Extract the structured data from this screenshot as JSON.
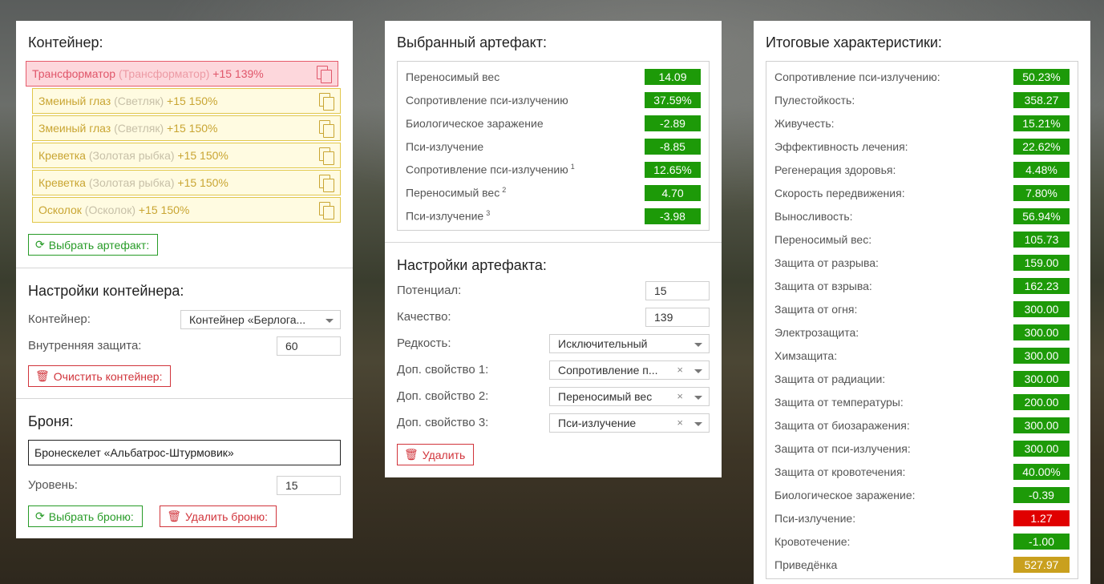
{
  "container_panel": {
    "title": "Контейнер:",
    "artifacts": [
      {
        "name": "Трансформатор",
        "original": "(Трансформатор)",
        "bonus": "+15 139%",
        "selected": true
      },
      {
        "name": "Змеиный глаз",
        "original": "(Светляк)",
        "bonus": "+15 150%",
        "selected": false
      },
      {
        "name": "Змеиный глаз",
        "original": "(Светляк)",
        "bonus": "+15 150%",
        "selected": false
      },
      {
        "name": "Креветка",
        "original": "(Золотая рыбка)",
        "bonus": "+15 150%",
        "selected": false
      },
      {
        "name": "Креветка",
        "original": "(Золотая рыбка)",
        "bonus": "+15 150%",
        "selected": false
      },
      {
        "name": "Осколок",
        "original": "(Осколок)",
        "bonus": "+15 150%",
        "selected": false
      }
    ],
    "choose_artifact_label": "Выбрать артефакт:"
  },
  "container_settings": {
    "title": "Настройки контейнера:",
    "container_label": "Контейнер:",
    "container_value": "Контейнер «Берлога...",
    "inner_protection_label": "Внутренняя защита:",
    "inner_protection_value": "60",
    "clear_label": "Очистить контейнер:"
  },
  "armor": {
    "title": "Броня:",
    "armor_value": "Бронескелет «Альбатрос-Штурмовик»",
    "level_label": "Уровень:",
    "level_value": "15",
    "choose_label": "Выбрать броню:",
    "delete_label": "Удалить броню:"
  },
  "selected_artifact": {
    "title": "Выбранный артефакт:",
    "stats": [
      {
        "label": "Переносимый вес",
        "sup": "",
        "value": "14.09"
      },
      {
        "label": "Сопротивление пси-излучению",
        "sup": "",
        "value": "37.59%"
      },
      {
        "label": "Биологическое заражение",
        "sup": "",
        "value": "-2.89"
      },
      {
        "label": "Пси-излучение",
        "sup": "",
        "value": "-8.85"
      },
      {
        "label": "Сопротивление пси-излучению",
        "sup": "1",
        "value": "12.65%"
      },
      {
        "label": "Переносимый вес",
        "sup": "2",
        "value": "4.70"
      },
      {
        "label": "Пси-излучение",
        "sup": "3",
        "value": "-3.98"
      }
    ]
  },
  "artifact_settings": {
    "title": "Настройки артефакта:",
    "potential_label": "Потенциал:",
    "potential_value": "15",
    "quality_label": "Качество:",
    "quality_value": "139",
    "rarity_label": "Редкость:",
    "rarity_value": "Исключительный",
    "extra1_label": "Доп. свойство 1:",
    "extra1_value": "Сопротивление п...",
    "extra2_label": "Доп. свойство 2:",
    "extra2_value": "Переносимый вес",
    "extra3_label": "Доп. свойство 3:",
    "extra3_value": "Пси-излучение",
    "clear_symbol": "×",
    "delete_label": "Удалить"
  },
  "totals": {
    "title": "Итоговые характеристики:",
    "stats": [
      {
        "label": "Сопротивление пси-излучению:",
        "value": "50.23%",
        "color": "#1d9a08"
      },
      {
        "label": "Пулестойкость:",
        "value": "358.27",
        "color": "#1d9a08"
      },
      {
        "label": "Живучесть:",
        "value": "15.21%",
        "color": "#1d9a08"
      },
      {
        "label": "Эффективность лечения:",
        "value": "22.62%",
        "color": "#1d9a08"
      },
      {
        "label": "Регенерация здоровья:",
        "value": "4.48%",
        "color": "#1d9a08"
      },
      {
        "label": "Скорость передвижения:",
        "value": "7.80%",
        "color": "#1d9a08"
      },
      {
        "label": "Выносливость:",
        "value": "56.94%",
        "color": "#1d9a08"
      },
      {
        "label": "Переносимый вес:",
        "value": "105.73",
        "color": "#1d9a08"
      },
      {
        "label": "Защита от разрыва:",
        "value": "159.00",
        "color": "#1d9a08"
      },
      {
        "label": "Защита от взрыва:",
        "value": "162.23",
        "color": "#1d9a08"
      },
      {
        "label": "Защита от огня:",
        "value": "300.00",
        "color": "#1d9a08"
      },
      {
        "label": "Электрозащита:",
        "value": "300.00",
        "color": "#1d9a08"
      },
      {
        "label": "Химзащита:",
        "value": "300.00",
        "color": "#1d9a08"
      },
      {
        "label": "Защита от радиации:",
        "value": "300.00",
        "color": "#1d9a08"
      },
      {
        "label": "Защита от температуры:",
        "value": "200.00",
        "color": "#1d9a08"
      },
      {
        "label": "Защита от биозаражения:",
        "value": "300.00",
        "color": "#1d9a08"
      },
      {
        "label": "Защита от пси-излучения:",
        "value": "300.00",
        "color": "#1d9a08"
      },
      {
        "label": "Защита от кровотечения:",
        "value": "40.00%",
        "color": "#1d9a08"
      },
      {
        "label": "Биологическое заражение:",
        "value": "-0.39",
        "color": "#1d9a08"
      },
      {
        "label": "Пси-излучение:",
        "value": "1.27",
        "color": "#e00000"
      },
      {
        "label": "Кровотечение:",
        "value": "-1.00",
        "color": "#1d9a08"
      },
      {
        "label": "Приведёнка",
        "value": "527.97",
        "color": "#c9a01e"
      }
    ]
  }
}
